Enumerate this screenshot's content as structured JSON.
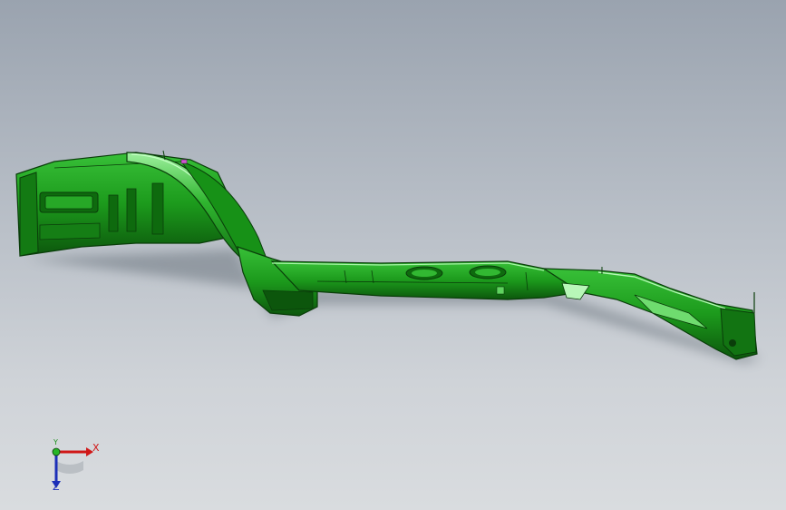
{
  "viewport": {
    "background_top": "#9aa3af",
    "background_bottom": "#d9dcdf"
  },
  "model": {
    "part_color": "#1f9b1f",
    "part_shade": "#0f5f0f",
    "part_highlight": "#8ee88e"
  },
  "triad": {
    "x_label": "X",
    "y_label": "Y",
    "z_label": "Z",
    "x_color": "#d01818",
    "y_color": "#1b8f1b",
    "z_color": "#1c2fb8"
  }
}
